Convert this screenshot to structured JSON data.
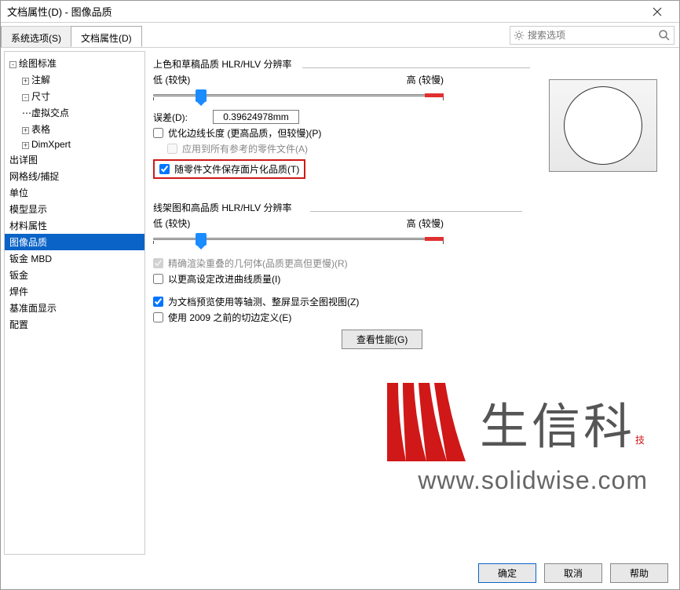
{
  "window": {
    "title": "文档属性(D) - 图像品质"
  },
  "tabs": {
    "system": "系统选项(S)",
    "doc": "文档属性(D)"
  },
  "search": {
    "placeholder": "搜索选项"
  },
  "tree": {
    "items": [
      {
        "label": "绘图标准",
        "level": 0,
        "exp": "-"
      },
      {
        "label": "注解",
        "level": 1,
        "exp": "+"
      },
      {
        "label": "尺寸",
        "level": 1,
        "exp": "-"
      },
      {
        "label": "虚拟交点",
        "level": 1,
        "exp": ""
      },
      {
        "label": "表格",
        "level": 1,
        "exp": "+"
      },
      {
        "label": "DimXpert",
        "level": 1,
        "exp": "+"
      },
      {
        "label": "出详图",
        "level": 0,
        "exp": ""
      },
      {
        "label": "网格线/捕捉",
        "level": 0,
        "exp": ""
      },
      {
        "label": "单位",
        "level": 0,
        "exp": ""
      },
      {
        "label": "模型显示",
        "level": 0,
        "exp": ""
      },
      {
        "label": "材料属性",
        "level": 0,
        "exp": ""
      },
      {
        "label": "图像品质",
        "level": 0,
        "exp": "",
        "selected": true
      },
      {
        "label": "钣金 MBD",
        "level": 0,
        "exp": ""
      },
      {
        "label": "钣金",
        "level": 0,
        "exp": ""
      },
      {
        "label": "焊件",
        "level": 0,
        "exp": ""
      },
      {
        "label": "基准面显示",
        "level": 0,
        "exp": ""
      },
      {
        "label": "配置",
        "level": 0,
        "exp": ""
      }
    ]
  },
  "section1": {
    "title": "上色和草稿品质 HLR/HLV 分辨率",
    "low": "低 (较快)",
    "high": "高 (较慢)",
    "deviation_label": "误差(D):",
    "deviation_value": "0.39624978mm",
    "opt_edge": "优化边线长度 (更高品质，但较慢)(P)",
    "apply_all": "应用到所有参考的零件文件(A)",
    "save_tess": "随零件文件保存面片化品质(T)"
  },
  "section2": {
    "title": "线架图和高品质 HLR/HLV 分辨率",
    "low": "低 (较快)",
    "high": "高 (较慢)",
    "accurate_render": "精确渲染重叠的几何体(品质更高但更慢)(R)",
    "higher_curve": "以更高设定改进曲线质量(I)"
  },
  "extra": {
    "iso_preview": "为文档预览使用等轴测、整屏显示全图视图(Z)",
    "pre2009": "使用 2009 之前的切边定义(E)",
    "perf_btn": "查看性能(G)"
  },
  "footer": {
    "ok": "确定",
    "cancel": "取消",
    "help": "帮助"
  },
  "watermark": {
    "cn": "生信科技",
    "url": "www.solidwise.com"
  }
}
